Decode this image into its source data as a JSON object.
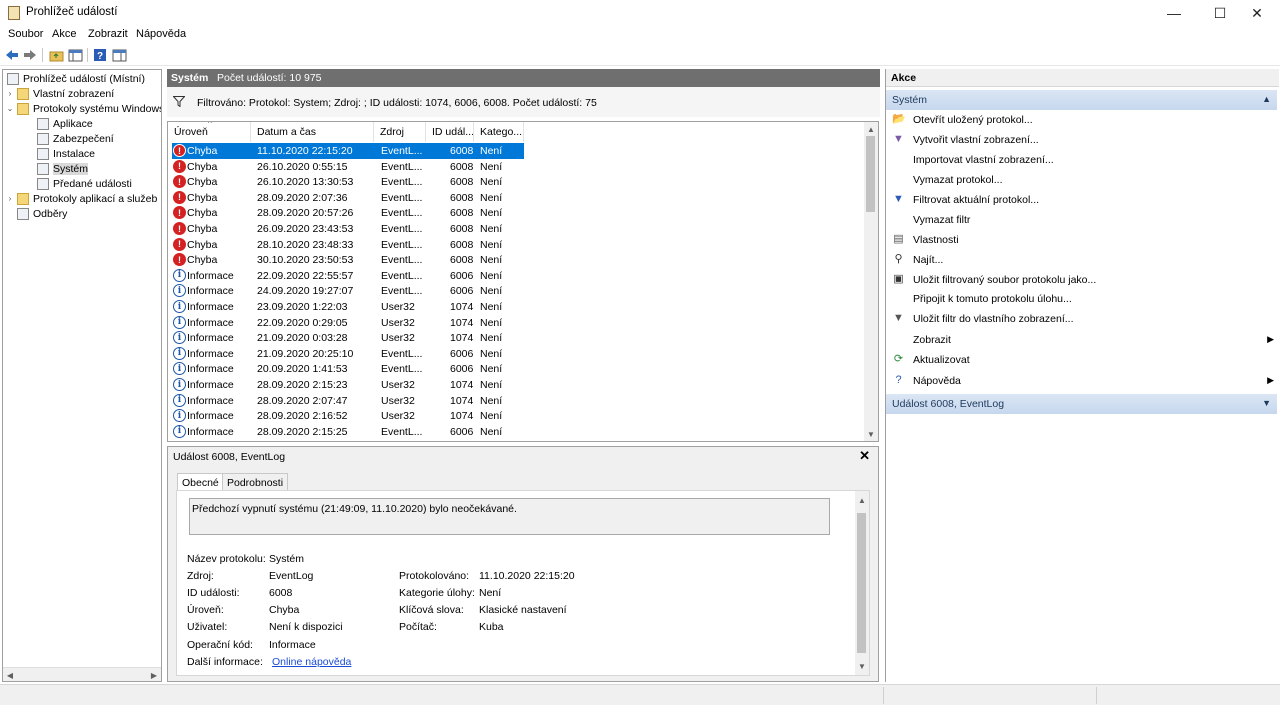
{
  "window": {
    "title": "Prohlížeč událostí",
    "minimize": "—",
    "maximize": "☐",
    "close": "✕"
  },
  "menu": [
    "Soubor",
    "Akce",
    "Zobrazit",
    "Nápověda"
  ],
  "tree": {
    "items": [
      {
        "label": "Prohlížeč událostí (Místní)",
        "chev": ""
      },
      {
        "label": "Vlastní zobrazení",
        "chev": "›"
      },
      {
        "label": "Protokoly systému Windows",
        "chev": "⌄"
      },
      {
        "label": "Aplikace",
        "chev": ""
      },
      {
        "label": "Zabezpečení",
        "chev": ""
      },
      {
        "label": "Instalace",
        "chev": ""
      },
      {
        "label": "Systém",
        "chev": ""
      },
      {
        "label": "Předané události",
        "chev": ""
      },
      {
        "label": "Protokoly aplikací a služeb",
        "chev": "›"
      },
      {
        "label": "Odběry",
        "chev": ""
      }
    ]
  },
  "center": {
    "log_name": "Systém",
    "event_count": "Počet událostí: 10 975",
    "filter_text": "Filtrováno: Protokol: System; Zdroj: ; ID události: 1074, 6006, 6008. Počet událostí: 75"
  },
  "table": {
    "columns": [
      "Úroveň",
      "Datum a čas",
      "Zdroj",
      "ID udál...",
      "Katego..."
    ],
    "rows": [
      {
        "level": "Chyba",
        "date": "11.10.2020 22:15:20",
        "source": "EventL...",
        "id": "6008",
        "category": "Není",
        "type": "err"
      },
      {
        "level": "Chyba",
        "date": "26.10.2020 0:55:15",
        "source": "EventL...",
        "id": "6008",
        "category": "Není",
        "type": "err"
      },
      {
        "level": "Chyba",
        "date": "26.10.2020 13:30:53",
        "source": "EventL...",
        "id": "6008",
        "category": "Není",
        "type": "err"
      },
      {
        "level": "Chyba",
        "date": "28.09.2020 2:07:36",
        "source": "EventL...",
        "id": "6008",
        "category": "Není",
        "type": "err"
      },
      {
        "level": "Chyba",
        "date": "28.09.2020 20:57:26",
        "source": "EventL...",
        "id": "6008",
        "category": "Není",
        "type": "err"
      },
      {
        "level": "Chyba",
        "date": "26.09.2020 23:43:53",
        "source": "EventL...",
        "id": "6008",
        "category": "Není",
        "type": "err"
      },
      {
        "level": "Chyba",
        "date": "28.10.2020 23:48:33",
        "source": "EventL...",
        "id": "6008",
        "category": "Není",
        "type": "err"
      },
      {
        "level": "Chyba",
        "date": "30.10.2020 23:50:53",
        "source": "EventL...",
        "id": "6008",
        "category": "Není",
        "type": "err"
      },
      {
        "level": "Informace",
        "date": "22.09.2020 22:55:57",
        "source": "EventL...",
        "id": "6006",
        "category": "Není",
        "type": "info"
      },
      {
        "level": "Informace",
        "date": "24.09.2020 19:27:07",
        "source": "EventL...",
        "id": "6006",
        "category": "Není",
        "type": "info"
      },
      {
        "level": "Informace",
        "date": "23.09.2020 1:22:03",
        "source": "User32",
        "id": "1074",
        "category": "Není",
        "type": "info"
      },
      {
        "level": "Informace",
        "date": "22.09.2020 0:29:05",
        "source": "User32",
        "id": "1074",
        "category": "Není",
        "type": "info"
      },
      {
        "level": "Informace",
        "date": "21.09.2020 0:03:28",
        "source": "User32",
        "id": "1074",
        "category": "Není",
        "type": "info"
      },
      {
        "level": "Informace",
        "date": "21.09.2020 20:25:10",
        "source": "EventL...",
        "id": "6006",
        "category": "Není",
        "type": "info"
      },
      {
        "level": "Informace",
        "date": "20.09.2020 1:41:53",
        "source": "EventL...",
        "id": "6006",
        "category": "Není",
        "type": "info"
      },
      {
        "level": "Informace",
        "date": "28.09.2020 2:15:23",
        "source": "User32",
        "id": "1074",
        "category": "Není",
        "type": "info"
      },
      {
        "level": "Informace",
        "date": "28.09.2020 2:07:47",
        "source": "User32",
        "id": "1074",
        "category": "Není",
        "type": "info"
      },
      {
        "level": "Informace",
        "date": "28.09.2020 2:16:52",
        "source": "User32",
        "id": "1074",
        "category": "Není",
        "type": "info"
      },
      {
        "level": "Informace",
        "date": "28.09.2020 2:15:25",
        "source": "EventL...",
        "id": "6006",
        "category": "Není",
        "type": "info"
      }
    ]
  },
  "detail": {
    "title": "Událost 6008, EventLog",
    "tabs": [
      "Obecné",
      "Podrobnosti"
    ],
    "description": "Předchozí vypnutí systému (21:49:09, 11.10.2020) bylo neočekávané.",
    "left": [
      {
        "label": "Název protokolu:",
        "value": "Systém"
      },
      {
        "label": "Zdroj:",
        "value": "EventLog"
      },
      {
        "label": "ID události:",
        "value": "6008"
      },
      {
        "label": "Úroveň:",
        "value": "Chyba"
      },
      {
        "label": "Uživatel:",
        "value": "Není k dispozici"
      },
      {
        "label": "Operační kód:",
        "value": "Informace"
      },
      {
        "label": "Další informace:",
        "value": "Online nápověda"
      }
    ],
    "right": [
      {
        "label": "Protokolováno:",
        "value": "11.10.2020 22:15:20"
      },
      {
        "label": "Kategorie úlohy:",
        "value": "Není"
      },
      {
        "label": "Klíčová slova:",
        "value": "Klasické nastavení"
      },
      {
        "label": "Počítač:",
        "value": "Kuba"
      }
    ]
  },
  "actions": {
    "header": "Akce",
    "section1": "Systém",
    "items": [
      {
        "label": "Otevřít uložený protokol...",
        "icon": "open-log-icon",
        "glyph": "📂",
        "sub": ""
      },
      {
        "label": "Vytvořit vlastní zobrazení...",
        "icon": "create-view-icon",
        "glyph": "▼",
        "sub": ""
      },
      {
        "label": "Importovat vlastní zobrazení...",
        "icon": "",
        "glyph": "",
        "sub": ""
      },
      {
        "label": "Vymazat protokol...",
        "icon": "",
        "glyph": "",
        "sub": ""
      },
      {
        "label": "Filtrovat aktuální protokol...",
        "icon": "filter-icon",
        "glyph": "▼",
        "sub": ""
      },
      {
        "label": "Vymazat filtr",
        "icon": "",
        "glyph": "",
        "sub": ""
      },
      {
        "label": "Vlastnosti",
        "icon": "properties-icon",
        "glyph": "▤",
        "sub": ""
      },
      {
        "label": "Najít...",
        "icon": "binoculars-icon",
        "glyph": "⚲",
        "sub": ""
      },
      {
        "label": "Uložit filtrovaný soubor protokolu jako...",
        "icon": "save-icon",
        "glyph": "▣",
        "sub": ""
      },
      {
        "label": "Připojit k tomuto protokolu úlohu...",
        "icon": "",
        "glyph": "",
        "sub": ""
      },
      {
        "label": "Uložit filtr do vlastního zobrazení...",
        "icon": "save-filter-icon",
        "glyph": "▼",
        "sub": ""
      },
      {
        "label": "Zobrazit",
        "icon": "",
        "glyph": "",
        "sub": "▶"
      },
      {
        "label": "Aktualizovat",
        "icon": "refresh-icon",
        "glyph": "⟳",
        "sub": ""
      },
      {
        "label": "Nápověda",
        "icon": "help-icon",
        "glyph": "?",
        "sub": "▶"
      }
    ],
    "section2": "Událost 6008, EventLog"
  },
  "colors": {
    "selection": "#0078d7",
    "error": "#d42121",
    "info": "#1c56a8",
    "header_gray": "#6f6f6f",
    "section_blue": "#c6d7ee"
  }
}
